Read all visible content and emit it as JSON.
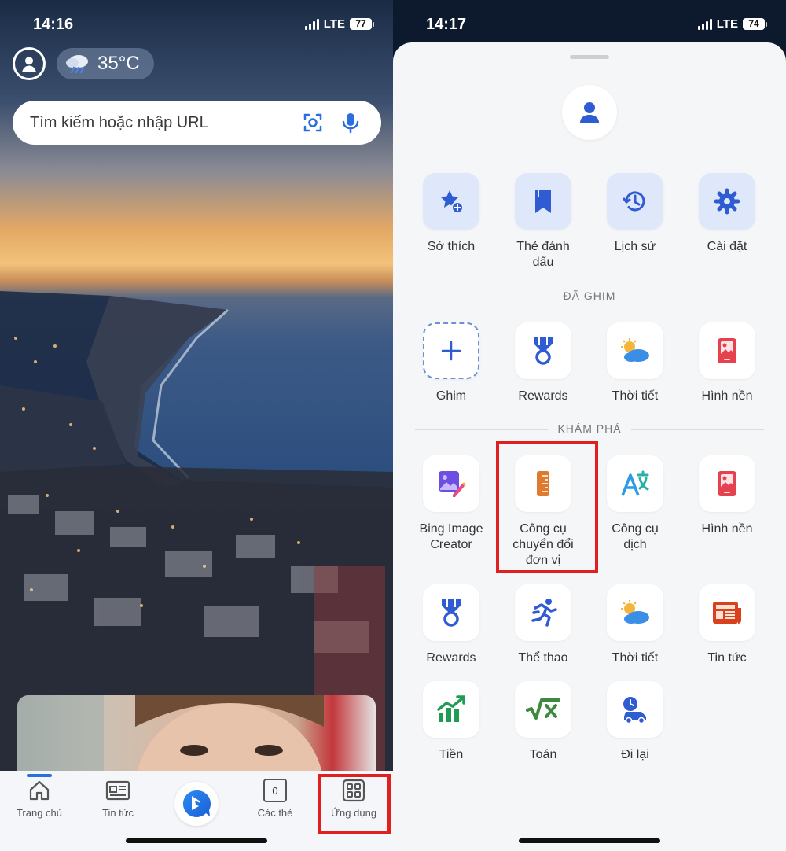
{
  "left": {
    "status": {
      "time": "14:16",
      "network": "LTE",
      "battery": "77"
    },
    "weather": {
      "temperature": "35°C"
    },
    "search": {
      "placeholder": "Tìm kiếm hoặc nhập URL"
    },
    "nav": {
      "home": "Trang chủ",
      "news": "Tin tức",
      "tabs": "Các thẻ",
      "tabs_count": "0",
      "apps": "Ứng dụng"
    }
  },
  "right": {
    "status": {
      "time": "14:17",
      "network": "LTE",
      "battery": "74"
    },
    "quick": [
      {
        "label": "Sở thích",
        "icon": "star-plus-icon"
      },
      {
        "label": "Thẻ đánh\ndấu",
        "icon": "bookmark-icon"
      },
      {
        "label": "Lịch sử",
        "icon": "history-icon"
      },
      {
        "label": "Cài đặt",
        "icon": "gear-icon"
      }
    ],
    "pinned_title": "ĐÃ GHIM",
    "pinned": [
      {
        "label": "Ghim",
        "icon": "plus-icon"
      },
      {
        "label": "Rewards",
        "icon": "medal-icon"
      },
      {
        "label": "Thời tiết",
        "icon": "weather-icon"
      },
      {
        "label": "Hình nền",
        "icon": "wallpaper-icon"
      }
    ],
    "explore_title": "KHÁM PHÁ",
    "explore": [
      {
        "label": "Bing Image\nCreator",
        "icon": "image-creator-icon"
      },
      {
        "label": "Công cụ\nchuyển đổi\nđơn vị",
        "icon": "ruler-icon"
      },
      {
        "label": "Công cụ\ndịch",
        "icon": "translate-icon"
      },
      {
        "label": "Hình nền",
        "icon": "wallpaper-icon"
      },
      {
        "label": "Rewards",
        "icon": "medal-icon"
      },
      {
        "label": "Thể thao",
        "icon": "runner-icon"
      },
      {
        "label": "Thời tiết",
        "icon": "weather-icon"
      },
      {
        "label": "Tin tức",
        "icon": "newspaper-icon"
      },
      {
        "label": "Tiền",
        "icon": "money-chart-icon"
      },
      {
        "label": "Toán",
        "icon": "math-icon"
      },
      {
        "label": "Đi lại",
        "icon": "commute-icon"
      }
    ]
  },
  "colors": {
    "accent": "#2a6fde",
    "highlight": "#e0201f",
    "sheet": "#f5f6f8"
  }
}
